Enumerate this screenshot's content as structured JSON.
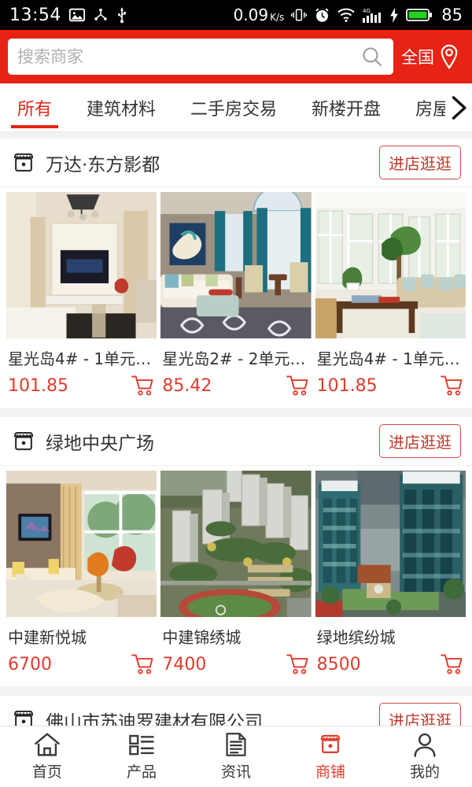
{
  "statusbar": {
    "time": "13:54",
    "icons_left": [
      "image-icon",
      "share-icon",
      "usb-icon"
    ],
    "net_speed": "0.09",
    "net_speed_unit": "K/s",
    "icons_right": [
      "vibrate-icon",
      "alarm-icon",
      "wifi-icon",
      "signal-4g-icon",
      "charging-bolt-icon",
      "battery-icon"
    ],
    "battery_level": "85"
  },
  "search": {
    "placeholder": "搜索商家",
    "value": "",
    "search_icon": "search-icon",
    "location_label": "全国",
    "location_icon": "location-pin-icon"
  },
  "tabs": {
    "items": [
      {
        "label": "所有",
        "active": true
      },
      {
        "label": "建筑材料",
        "active": false
      },
      {
        "label": "二手房交易",
        "active": false
      },
      {
        "label": "新楼开盘",
        "active": false
      },
      {
        "label": "房屋",
        "active": false
      }
    ],
    "more_arrow_icon": "chevron-right-icon"
  },
  "stores": [
    {
      "icon": "shop-icon",
      "name": "万达·东方影都",
      "enter_label": "进店逛逛",
      "products": [
        {
          "title": "星光岛4# - 1单元 - ...",
          "price": "101.85",
          "cart_icon": "cart-icon",
          "image": "living-room-chandelier-tv"
        },
        {
          "title": "星光岛2# - 2单元 - ...",
          "price": "85.42",
          "cart_icon": "cart-icon",
          "image": "living-room-teal-curtains"
        },
        {
          "title": "星光岛4# - 1单元 - ...",
          "price": "101.85",
          "cart_icon": "cart-icon",
          "image": "bright-sunroom-plants"
        }
      ]
    },
    {
      "icon": "shop-icon",
      "name": "绿地中央广场",
      "enter_label": "进店逛逛",
      "products": [
        {
          "title": "中建新悦城",
          "price": "6700",
          "cart_icon": "cart-icon",
          "image": "modern-living-room-warm"
        },
        {
          "title": "中建锦绣城",
          "price": "7400",
          "cart_icon": "cart-icon",
          "image": "aerial-residential-complex"
        },
        {
          "title": "绿地缤纷城",
          "price": "8500",
          "cart_icon": "cart-icon",
          "image": "teal-glass-towers"
        }
      ]
    },
    {
      "icon": "shop-icon",
      "name": "佛山市苏迪罗建材有限公司",
      "enter_label": "进店逛逛",
      "products": []
    }
  ],
  "tabbar": {
    "items": [
      {
        "label": "首页",
        "icon": "home-icon",
        "active": false
      },
      {
        "label": "产品",
        "icon": "list-icon",
        "active": false
      },
      {
        "label": "资讯",
        "icon": "document-icon",
        "active": false
      },
      {
        "label": "商铺",
        "icon": "shop-icon",
        "active": true
      },
      {
        "label": "我的",
        "icon": "person-icon",
        "active": false
      }
    ]
  },
  "colors": {
    "brand_red": "#e62314",
    "price_red": "#e03c2d",
    "status_bar_bg": "#000000",
    "page_bg": "#f2f2f2"
  }
}
